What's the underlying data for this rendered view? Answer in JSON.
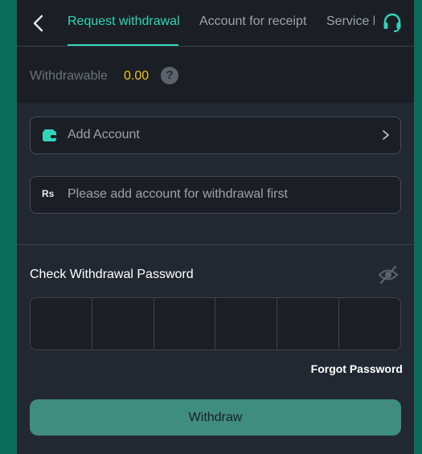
{
  "header": {
    "tabs": [
      {
        "label": "Request withdrawal",
        "active": true
      },
      {
        "label": "Account for receipt",
        "active": false
      },
      {
        "label": "Service history",
        "active": false
      }
    ]
  },
  "balance": {
    "label": "Withdrawable",
    "value": "0.00",
    "help_symbol": "?"
  },
  "add_account": {
    "label": "Add Account"
  },
  "account_field": {
    "currency_symbol": "Rs",
    "placeholder": "Please add account for withdrawal first"
  },
  "password": {
    "title": "Check Withdrawal Password",
    "digits": 6,
    "forgot_label": "Forgot Password"
  },
  "withdraw_button": {
    "label": "Withdraw"
  },
  "colors": {
    "accent": "#2fd5bb",
    "balance_value": "#f0c419",
    "button": "#3e8d7f",
    "side_bg": "#0b6c5c"
  },
  "icons": [
    "back-arrow-icon",
    "headset-icon",
    "help-icon",
    "wallet-icon",
    "chevron-right-icon",
    "rupee-icon",
    "eye-off-icon"
  ]
}
